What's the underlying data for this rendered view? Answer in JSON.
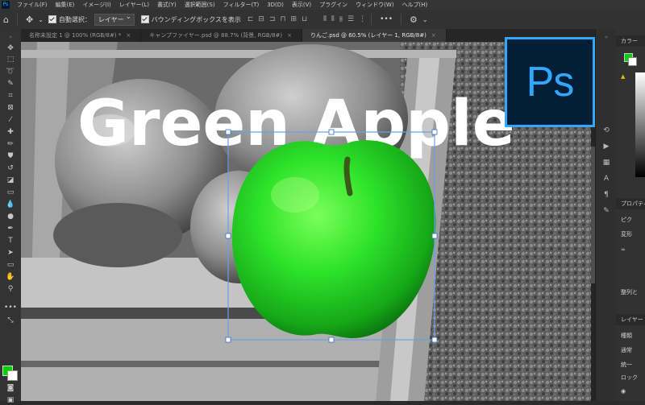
{
  "menubar": {
    "app_icon": "Ps",
    "items": [
      "ファイル(F)",
      "編集(E)",
      "イメージ(I)",
      "レイヤー(L)",
      "書式(Y)",
      "選択範囲(S)",
      "フィルター(T)",
      "3D(D)",
      "表示(V)",
      "プラグイン",
      "ウィンドウ(W)",
      "ヘルプ(H)"
    ]
  },
  "options": {
    "auto_select_label": "自動選択：",
    "layer_select": "レイヤー",
    "bounding_label": "バウンディングボックスを表示",
    "more": "•••"
  },
  "tabs": [
    {
      "label": "名称未設定 1 @ 100% (RGB/8#) *",
      "close": "×"
    },
    {
      "label": "キャンプファイヤー.psd @ 88.7% (背景, RGB/8#)",
      "close": "×"
    },
    {
      "label": "りんご.psd @ 60.5% (レイヤー 1, RGB/8#)",
      "close": "×"
    }
  ],
  "canvas": {
    "headline": "Green Apple"
  },
  "logo": {
    "text": "Ps"
  },
  "right_panel": {
    "color_header": "カラー",
    "properties_header": "プロパティ",
    "pixel_label": "ピク",
    "transform_label": "変形",
    "align_label": "整列と",
    "layers_header": "レイヤー",
    "kind_label": "種類",
    "mode_label": "通常",
    "unify_label": "統一",
    "lock_label": "ロック"
  },
  "colors": {
    "foreground": "#00d400",
    "background": "#ffffff",
    "accent": "#31a8ff"
  }
}
